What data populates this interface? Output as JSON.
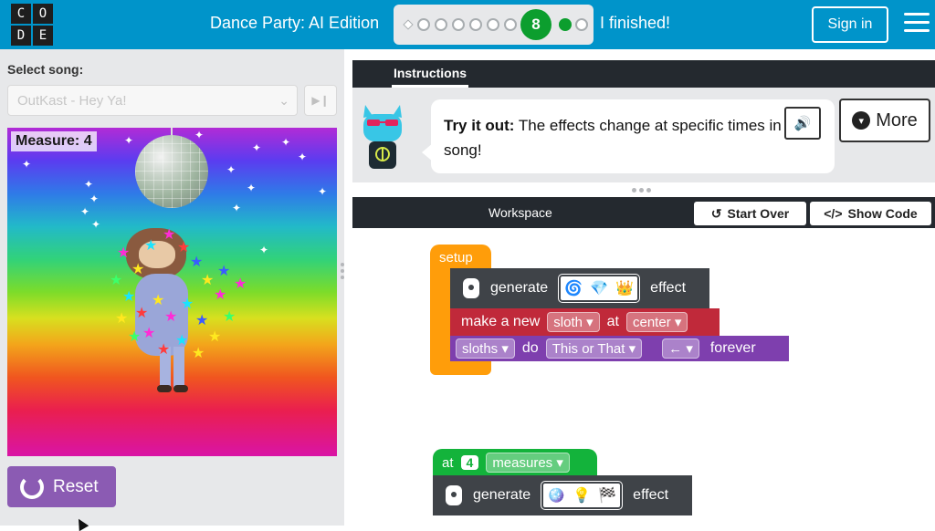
{
  "header": {
    "logo_letters": [
      "C",
      "O",
      "D",
      "E"
    ],
    "title": "Dance Party: AI Edition",
    "current_level": "8",
    "finished_label": "I finished!",
    "signin_label": "Sign in",
    "menu_icon": "hamburger-icon"
  },
  "left_panel": {
    "select_song_label": "Select song:",
    "song_value": "OutKast - Hey Ya!",
    "play_icon": "play-pause-icon",
    "measure_label": "Measure: 4",
    "reset_label": "Reset",
    "reset_icon": "rotate-icon"
  },
  "instructions": {
    "tab_label": "Instructions",
    "bold_text": "Try it out:",
    "text": " The effects change at specific times in the song!",
    "tts_icon": "text-to-speech-icon",
    "more_label": "More",
    "more_icon": "chevron-down-icon"
  },
  "workspace": {
    "title": "Workspace",
    "start_over_label": "Start Over",
    "start_over_icon": "undo-icon",
    "show_code_label": "Show Code",
    "show_code_icon": "code-icon",
    "setup_label": "setup",
    "generate_label": "generate",
    "effect_label": "effect",
    "effect_icons_1": [
      "🌀",
      "💎",
      "👑"
    ],
    "make_label": "make a new",
    "sprite_value": "sloth",
    "at_label": "at",
    "location_value": "center",
    "group_value": "sloths",
    "do_label": "do",
    "move_value": "This or That",
    "direction_value": "←",
    "forever_label": "forever",
    "measure_at_label": "at",
    "measure_num": "4",
    "measures_value": "measures",
    "effect_icons_2": [
      "🪩",
      "💡",
      "🏁"
    ]
  },
  "colors": {
    "header": "#0094ca",
    "setup_block": "#ff9d0a",
    "generate_block": "#3f4348",
    "make_block": "#c0293a",
    "sloths_block": "#7e3fae",
    "at_block": "#13b33b",
    "reset_button": "#8b5bb3"
  }
}
